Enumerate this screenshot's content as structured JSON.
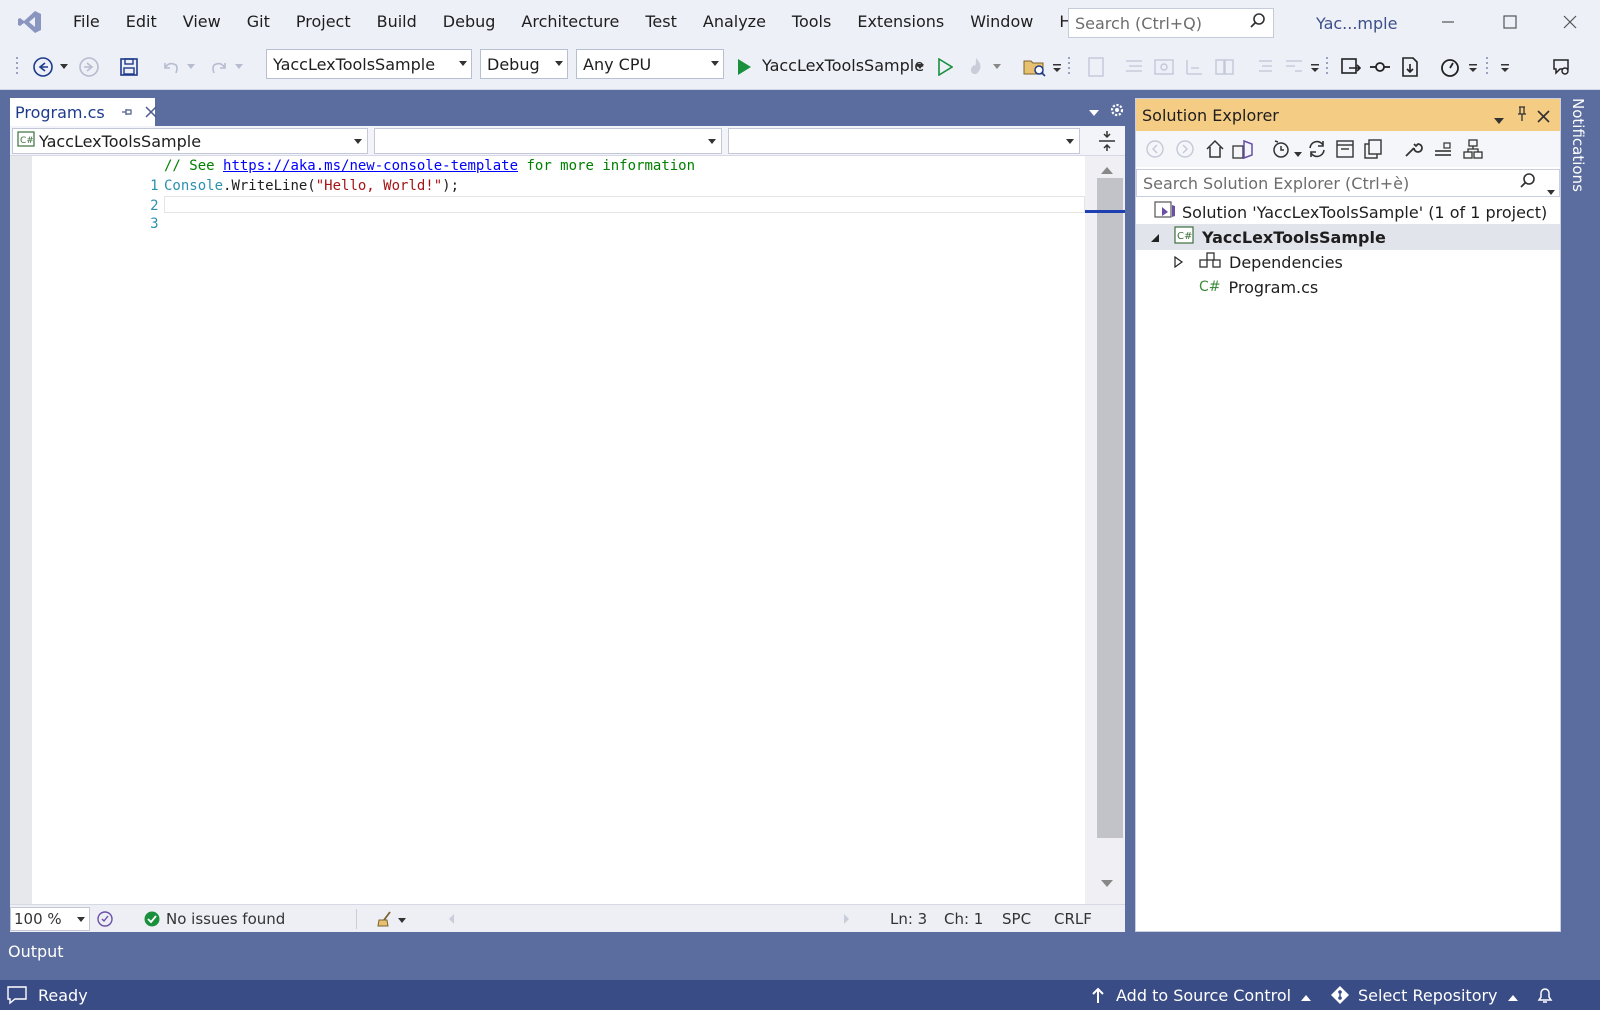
{
  "menu": {
    "items": [
      "File",
      "Edit",
      "View",
      "Git",
      "Project",
      "Build",
      "Debug",
      "Architecture",
      "Test",
      "Analyze",
      "Tools",
      "Extensions",
      "Window",
      "Help"
    ]
  },
  "search": {
    "placeholder": "Search (Ctrl+Q)"
  },
  "window": {
    "title": "Yac...mple"
  },
  "toolbar": {
    "project_combo": "YaccLexToolsSample",
    "config_combo": "Debug",
    "platform_combo": "Any CPU",
    "run_target": "YaccLexToolsSample"
  },
  "document": {
    "tab_label": "Program.cs",
    "nav_project": "YaccLexToolsSample",
    "nav_type": "",
    "nav_member": ""
  },
  "code": {
    "line_numbers": [
      "1",
      "2",
      "3"
    ],
    "line1": {
      "prefix": "// See ",
      "link": "https://aka.ms/new-console-template",
      "suffix": " for more information"
    },
    "line2": {
      "class": "Console",
      "method": ".WriteLine(",
      "string": "\"Hello, World!\"",
      "end": ");"
    },
    "line3": ""
  },
  "editor_status": {
    "zoom": "100 %",
    "issues": "No issues found",
    "line": "Ln: 3",
    "column": "Ch: 1",
    "whitespace": "SPC",
    "line_ending": "CRLF"
  },
  "solution_explorer": {
    "title": "Solution Explorer",
    "search_placeholder": "Search Solution Explorer (Ctrl+è)",
    "tree": [
      {
        "label": "Solution 'YaccLexToolsSample' (1 of 1 project)",
        "icon": "solution-icon"
      },
      {
        "label": "YaccLexToolsSample",
        "icon": "csharp-project-icon",
        "bold": true
      },
      {
        "label": "Dependencies",
        "icon": "dependencies-icon"
      },
      {
        "label": "Program.cs",
        "icon": "csharp-file-icon"
      }
    ]
  },
  "rail": {
    "notifications": "Notifications"
  },
  "output": {
    "label": "Output"
  },
  "statusbar": {
    "ready": "Ready",
    "source_control": "Add to Source Control",
    "repository": "Select Repository"
  },
  "colors": {
    "background": "#5b6c9e",
    "chrome": "#eef0f8",
    "solution_explorer_header": "#f5cc84",
    "statusbar": "#394c86",
    "accent": "#1e3b8c"
  }
}
